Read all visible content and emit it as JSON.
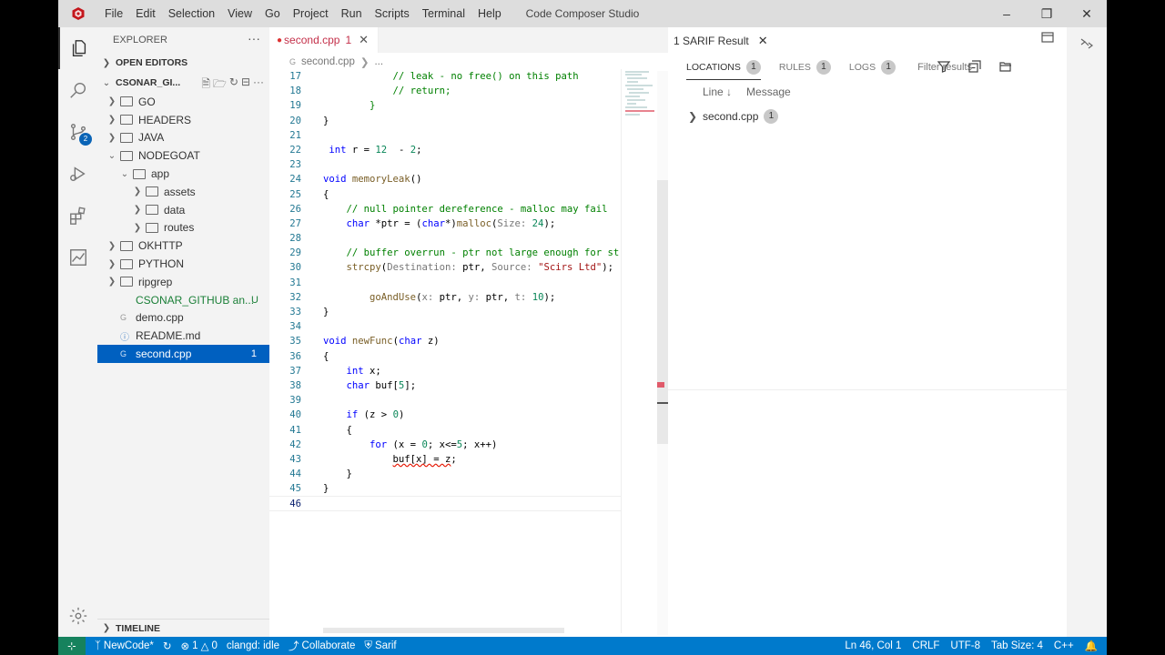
{
  "window": {
    "title": "Code Composer Studio",
    "menu": [
      "File",
      "Edit",
      "Selection",
      "View",
      "Go",
      "Project",
      "Run",
      "Scripts",
      "Terminal",
      "Help"
    ]
  },
  "activity_bar": {
    "scm_badge": "2"
  },
  "sidebar": {
    "title": "EXPLORER",
    "open_editors": "OPEN EDITORS",
    "workspace": "CSONAR_GI...",
    "tree": [
      {
        "label": "GO",
        "type": "folder",
        "depth": 0,
        "state": "closed"
      },
      {
        "label": "HEADERS",
        "type": "folder",
        "depth": 0,
        "state": "closed"
      },
      {
        "label": "JAVA",
        "type": "folder",
        "depth": 0,
        "state": "closed"
      },
      {
        "label": "NODEGOAT",
        "type": "folder",
        "depth": 0,
        "state": "open"
      },
      {
        "label": "app",
        "type": "folder",
        "depth": 1,
        "state": "open"
      },
      {
        "label": "assets",
        "type": "folder",
        "depth": 2,
        "state": "closed"
      },
      {
        "label": "data",
        "type": "folder",
        "depth": 2,
        "state": "closed"
      },
      {
        "label": "routes",
        "type": "folder",
        "depth": 2,
        "state": "closed"
      },
      {
        "label": "OKHTTP",
        "type": "folder",
        "depth": 0,
        "state": "closed"
      },
      {
        "label": "PYTHON",
        "type": "folder",
        "depth": 0,
        "state": "closed"
      },
      {
        "label": "ripgrep",
        "type": "folder",
        "depth": 0,
        "state": "closed"
      },
      {
        "label": "CSONAR_GITHUB an...",
        "type": "file",
        "depth": 0,
        "status": "U"
      },
      {
        "label": "demo.cpp",
        "type": "cpp",
        "depth": 0
      },
      {
        "label": "README.md",
        "type": "md",
        "depth": 0
      },
      {
        "label": "second.cpp",
        "type": "cpp",
        "depth": 0,
        "selected": true,
        "count": "1"
      }
    ],
    "timeline": "TIMELINE"
  },
  "editor": {
    "tab": {
      "label": "second.cpp",
      "count": "1"
    },
    "breadcrumb": [
      "second.cpp",
      "..."
    ],
    "cursor_line": "46",
    "lines": [
      {
        "n": "17",
        "html": "            <span class=\"cm\">// leak - no free() on this path</span>"
      },
      {
        "n": "18",
        "html": "            <span class=\"cm\">// return;</span>"
      },
      {
        "n": "19",
        "html": "        <span class=\"cm\">}</span>"
      },
      {
        "n": "20",
        "html": "}"
      },
      {
        "n": "21",
        "html": ""
      },
      {
        "n": "22",
        "html": " <span class=\"kw\">int</span> r = <span class=\"nm\">12</span>  - <span class=\"nm\">2</span>;"
      },
      {
        "n": "23",
        "html": ""
      },
      {
        "n": "24",
        "html": "<span class=\"kw\">void</span> <span class=\"fn\">memoryLeak</span>()"
      },
      {
        "n": "25",
        "html": "{"
      },
      {
        "n": "26",
        "html": "    <span class=\"cm\">// null pointer dereference - malloc may fail</span>"
      },
      {
        "n": "27",
        "html": "    <span class=\"kw\">char</span> *ptr = (<span class=\"kw\">char</span>*)<span class=\"fn\">malloc</span>(<span class=\"hint\">Size:</span> <span class=\"nm\">24</span>);"
      },
      {
        "n": "28",
        "html": ""
      },
      {
        "n": "29",
        "html": "    <span class=\"cm\">// buffer overrun - ptr not large enough for st</span>"
      },
      {
        "n": "30",
        "html": "    <span class=\"fn\">strcpy</span>(<span class=\"hint\">Destination:</span> ptr, <span class=\"hint\">Source:</span> <span class=\"st\">\"Scirs Ltd\"</span>);"
      },
      {
        "n": "31",
        "html": ""
      },
      {
        "n": "32",
        "html": "        <span class=\"fn\">goAndUse</span>(<span class=\"hint\">x:</span> ptr, <span class=\"hint\">y:</span> ptr, <span class=\"hint\">t:</span> <span class=\"nm\">10</span>);"
      },
      {
        "n": "33",
        "html": "}"
      },
      {
        "n": "34",
        "html": ""
      },
      {
        "n": "35",
        "html": "<span class=\"kw\">void</span> <span class=\"fn\">newFunc</span>(<span class=\"kw\">char</span> z)"
      },
      {
        "n": "36",
        "html": "{"
      },
      {
        "n": "37",
        "html": "    <span class=\"kw\">int</span> x;"
      },
      {
        "n": "38",
        "html": "    <span class=\"kw\">char</span> buf[<span class=\"nm\">5</span>];"
      },
      {
        "n": "39",
        "html": ""
      },
      {
        "n": "40",
        "html": "    <span class=\"kw\">if</span> (z &gt; <span class=\"nm\">0</span>)"
      },
      {
        "n": "41",
        "html": "    {"
      },
      {
        "n": "42",
        "html": "        <span class=\"kw\">for</span> (x = <span class=\"nm\">0</span>; x&lt;=<span class=\"nm\">5</span>; x++)"
      },
      {
        "n": "43",
        "html": "            <span class=\"sq\">buf[x] = z</span>;"
      },
      {
        "n": "44",
        "html": "    }"
      },
      {
        "n": "45",
        "html": "}"
      },
      {
        "n": "46",
        "html": ""
      }
    ]
  },
  "sarif": {
    "tab_label": "1 SARIF Result",
    "filters": [
      {
        "label": "LOCATIONS",
        "count": "1",
        "active": true
      },
      {
        "label": "RULES",
        "count": "1",
        "active": false
      },
      {
        "label": "LOGS",
        "count": "1",
        "active": false
      }
    ],
    "filter_placeholder": "Filter results",
    "col_line": "Line ↓",
    "col_message": "Message",
    "location_file": "second.cpp",
    "location_count": "1"
  },
  "statusbar": {
    "branch": "NewCode*",
    "errors": "1",
    "warnings": "0",
    "clangd": "clangd: idle",
    "collaborate": "Collaborate",
    "sarif": "Sarif",
    "position": "Ln 46, Col 1",
    "eol": "CRLF",
    "encoding": "UTF-8",
    "tab_size": "Tab Size: 4",
    "language": "C++"
  },
  "colors": {
    "status_bar": "#007acc",
    "remote": "#16825d",
    "selection": "#0060c0",
    "error": "#c4304a"
  }
}
